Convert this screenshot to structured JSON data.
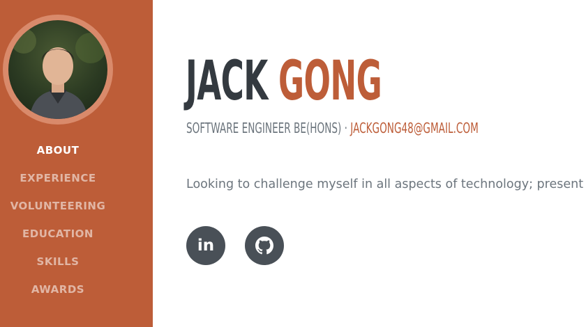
{
  "sidebar": {
    "avatar_alt": "profile photo",
    "nav": [
      {
        "label": "ABOUT",
        "active": true
      },
      {
        "label": "EXPERIENCE",
        "active": false
      },
      {
        "label": "VOLUNTEERING",
        "active": false
      },
      {
        "label": "EDUCATION",
        "active": false
      },
      {
        "label": "SKILLS",
        "active": false
      },
      {
        "label": "AWARDS",
        "active": false
      }
    ]
  },
  "about": {
    "first_name": "JACK",
    "last_name": "GONG",
    "subtitle": "SOFTWARE ENGINEER BE(HONS)",
    "separator": " · ",
    "email": "JACKGONG48@GMAIL.COM",
    "lead": "Looking to challenge myself in all aspects of technology; present and",
    "social": [
      {
        "icon": "linkedin-icon",
        "label": "in"
      },
      {
        "icon": "github-icon"
      }
    ]
  },
  "colors": {
    "accent": "#bd5d38",
    "heading": "#343a40",
    "muted": "#6c757d",
    "social_bg": "#495057"
  }
}
